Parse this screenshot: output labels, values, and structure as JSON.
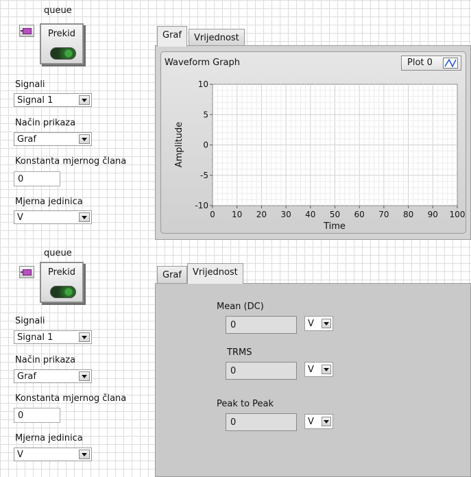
{
  "panel_top": {
    "queue_label": "queue",
    "stop_button_label": "Prekid",
    "signali_label": "Signali",
    "signali_value": "Signal 1",
    "nacin_label": "Način prikaza",
    "nacin_value": "Graf",
    "konstanta_label": "Konstanta mjernog člana",
    "konstanta_value": "0",
    "jedinica_label": "Mjerna jedinica",
    "jedinica_value": "V",
    "tabs": [
      {
        "label": "Graf",
        "active": true
      },
      {
        "label": "Vrijednost",
        "active": false
      }
    ],
    "graph": {
      "title": "Waveform Graph",
      "legend_plot": "Plot 0",
      "xlabel": "Time",
      "ylabel": "Amplitude"
    }
  },
  "panel_bottom": {
    "queue_label": "queue",
    "stop_button_label": "Prekid",
    "signali_label": "Signali",
    "signali_value": "Signal 1",
    "nacin_label": "Način prikaza",
    "nacin_value": "Graf",
    "konstanta_label": "Konstanta mjernog člana",
    "konstanta_value": "0",
    "jedinica_label": "Mjerna jedinica",
    "jedinica_value": "V",
    "tabs": [
      {
        "label": "Graf",
        "active": false
      },
      {
        "label": "Vrijednost",
        "active": true
      }
    ],
    "measurements": [
      {
        "label": "Mean (DC)",
        "value": "0",
        "unit": "V"
      },
      {
        "label": "TRMS",
        "value": "0",
        "unit": "V"
      },
      {
        "label": "Peak to Peak",
        "value": "0",
        "unit": "V"
      }
    ]
  },
  "chart_data": {
    "type": "line",
    "title": "Waveform Graph",
    "xlabel": "Time",
    "ylabel": "Amplitude",
    "xlim": [
      0,
      100
    ],
    "ylim": [
      -10,
      10
    ],
    "x_ticks": [
      0,
      10,
      20,
      30,
      40,
      50,
      60,
      70,
      80,
      90,
      100
    ],
    "y_ticks": [
      10,
      5,
      0,
      -5,
      -10
    ],
    "grid": true,
    "series": [
      {
        "name": "Plot 0",
        "x": [],
        "y": []
      }
    ],
    "legend": "top-right"
  }
}
